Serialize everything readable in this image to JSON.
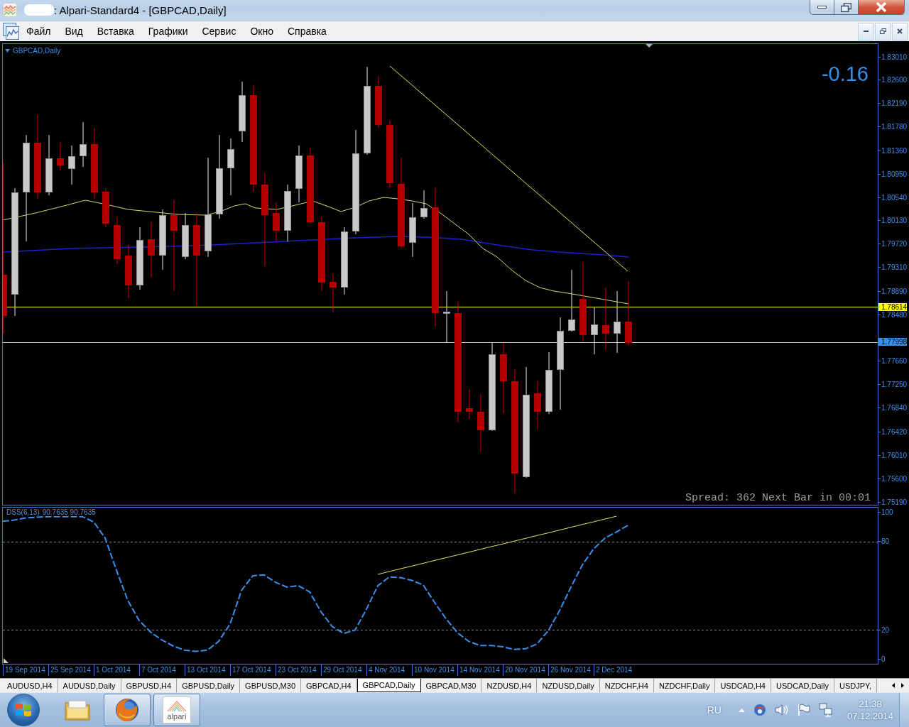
{
  "window": {
    "title": ": Alpari-Standard4 - [GBPCAD,Daily]"
  },
  "menu": [
    "Файл",
    "Вид",
    "Вставка",
    "Графики",
    "Сервис",
    "Окно",
    "Справка"
  ],
  "chart": {
    "symbol": "GBPCAD,Daily",
    "change": "-0.16",
    "status": "Spread: 362 Next Bar in 00:01",
    "price_axis": [
      "1.83010",
      "1.82600",
      "1.82190",
      "1.81780",
      "1.81360",
      "1.80950",
      "1.80540",
      "1.80130",
      "1.79720",
      "1.79310",
      "1.78890",
      "1.78480",
      "1.77660",
      "1.77250",
      "1.76840",
      "1.76420",
      "1.76010",
      "1.75600",
      "1.75190"
    ],
    "price_markers": [
      {
        "kind": "hline",
        "label": "1.78614",
        "color": "#ffff00"
      },
      {
        "kind": "bid",
        "label": "1.77998",
        "color": "#3c8fe8"
      }
    ],
    "time_axis": [
      "19 Sep 2014",
      "25 Sep 2014",
      "1 Oct 2014",
      "7 Oct 2014",
      "13 Oct 2014",
      "17 Oct 2014",
      "23 Oct 2014",
      "29 Oct 2014",
      "4 Nov 2014",
      "10 Nov 2014",
      "14 Nov 2014",
      "20 Nov 2014",
      "26 Nov 2014",
      "2 Dec 2014"
    ]
  },
  "indicator": {
    "readout": "90.7635 90.7635",
    "chart_data": {
      "type": "line",
      "series": [
        {
          "name": "DSS(6,13)",
          "color": "#3c8fe8",
          "line_style": "dashed",
          "values": [
            93.6,
            94.5,
            95.9,
            96.4,
            96.8,
            96.8,
            96.8,
            96.8,
            93.2,
            82.3,
            60.5,
            40,
            26.4,
            18.6,
            13.2,
            9.1,
            6.4,
            5.5,
            6.4,
            12.3,
            24.1,
            46.8,
            56.8,
            57.3,
            52.3,
            49.1,
            50,
            45.9,
            32.3,
            22.3,
            17.7,
            20,
            34.1,
            50,
            55.9,
            55.5,
            53.6,
            50.5,
            38.6,
            27.7,
            18.2,
            12.3,
            9.5,
            9.5,
            8.6,
            6.8,
            7.3,
            10.5,
            19.5,
            33.2,
            49.1,
            64.1,
            75,
            82.3,
            86.4,
            90.8
          ]
        },
        {
          "color": "#e6e65a",
          "line_style": "solid",
          "values": [
            null,
            null,
            null,
            null,
            null,
            null,
            null,
            null,
            null,
            null,
            null,
            null,
            null,
            null,
            null,
            null,
            null,
            null,
            null,
            null,
            null,
            null,
            null,
            null,
            null,
            null,
            null,
            null,
            null,
            null,
            null,
            null,
            null,
            57.7,
            59.6,
            61.5,
            63.3,
            65.2,
            67.1,
            69,
            70.8,
            72.7,
            74.6,
            76.5,
            78.3,
            80.2,
            82.1,
            84,
            85.8,
            87.7,
            89.6,
            91.5,
            93.3,
            95.2,
            97.1,
            null
          ]
        }
      ],
      "ylim": [
        -2.9,
        102.9
      ],
      "yticks": [
        0,
        20,
        80,
        100
      ]
    }
  },
  "tabs": [
    {
      "label": "AUDUSD,H4",
      "selected": false
    },
    {
      "label": "AUDUSD,Daily",
      "selected": false
    },
    {
      "label": "GBPUSD,H4",
      "selected": false
    },
    {
      "label": "GBPUSD,Daily",
      "selected": false
    },
    {
      "label": "GBPUSD,M30",
      "selected": false
    },
    {
      "label": "GBPCAD,H4",
      "selected": false
    },
    {
      "label": "GBPCAD,Daily",
      "selected": true
    },
    {
      "label": "GBPCAD,M30",
      "selected": false
    },
    {
      "label": "NZDUSD,H4",
      "selected": false
    },
    {
      "label": "NZDUSD,Daily",
      "selected": false
    },
    {
      "label": "NZDCHF,H4",
      "selected": false
    },
    {
      "label": "NZDCHF,Daily",
      "selected": false
    },
    {
      "label": "USDCAD,H4",
      "selected": false
    },
    {
      "label": "USDCAD,Daily",
      "selected": false
    },
    {
      "label": "USDJPY,",
      "selected": false
    }
  ],
  "taskbar": {
    "apps": [
      {
        "kind": "folder",
        "running": false
      },
      {
        "kind": "browser",
        "running": true
      },
      {
        "kind": "alpari",
        "label": "alpari",
        "running": true
      }
    ],
    "language": "RU",
    "time": "21:38",
    "date": "07.12.2014"
  }
}
